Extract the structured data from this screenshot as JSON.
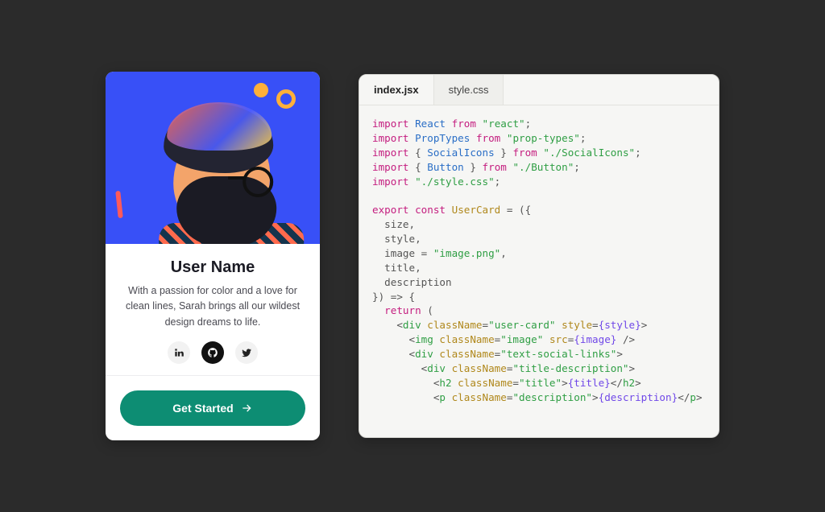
{
  "card": {
    "title": "User Name",
    "description": "With a passion for color and a love for clean lines, Sarah brings all our wildest design dreams to life.",
    "socials": {
      "linkedin": "linkedin-icon",
      "github": "github-icon",
      "twitter": "twitter-icon"
    },
    "cta_label": "Get Started"
  },
  "editor": {
    "tabs": [
      {
        "label": "index.jsx",
        "active": true
      },
      {
        "label": "style.css",
        "active": false
      }
    ],
    "code": {
      "l1": {
        "kw": "import",
        "id": "React",
        "from": "from",
        "str": "\"react\""
      },
      "l2": {
        "kw": "import",
        "id": "PropTypes",
        "from": "from",
        "str": "\"prop-types\""
      },
      "l3": {
        "kw": "import",
        "lb": "{ ",
        "id": "SocialIcons",
        "rb": " }",
        "from": "from",
        "str": "\"./SocialIcons\""
      },
      "l4": {
        "kw": "import",
        "lb": "{ ",
        "id": "Button",
        "rb": " }",
        "from": "from",
        "str": "\"./Button\""
      },
      "l5": {
        "kw": "import",
        "str": "\"./style.css\""
      },
      "l6": {
        "kw1": "export",
        "kw2": "const",
        "fn": "UserCard",
        "tail": " = ({"
      },
      "l7": "  size,",
      "l8": "  style,",
      "l9a": "  image = ",
      "l9b": "\"image.png\"",
      "l9c": ",",
      "l10": "  title,",
      "l11": "  description",
      "l12": "}) => {",
      "l13": {
        "kw": "return",
        "tail": " ("
      },
      "l14": {
        "open": "    <",
        "tag": "div",
        "a1": "className",
        "v1": "\"user-card\"",
        "a2": "style",
        "v2": "{style}",
        "close": ">"
      },
      "l15": {
        "open": "      <",
        "tag": "img",
        "a1": "className",
        "v1": "\"image\"",
        "a2": "src",
        "v2": "{image}",
        "close": " />"
      },
      "l16": {
        "open": "      <",
        "tag": "div",
        "a1": "className",
        "v1": "\"text-social-links\"",
        "close": ">"
      },
      "l17": {
        "open": "        <",
        "tag": "div",
        "a1": "className",
        "v1": "\"title-description\"",
        "close": ">"
      },
      "l18": {
        "open": "          <",
        "tag": "h2",
        "a1": "className",
        "v1": "\"title\"",
        "mid": ">",
        "inner": "{title}",
        "end": "</",
        "tag2": "h2",
        "end2": ">"
      },
      "l19": {
        "open": "          <",
        "tag": "p",
        "a1": "className",
        "v1": "\"description\"",
        "mid": ">",
        "inner": "{description}",
        "end": "</",
        "tag2": "p",
        "end2": ">"
      }
    }
  }
}
